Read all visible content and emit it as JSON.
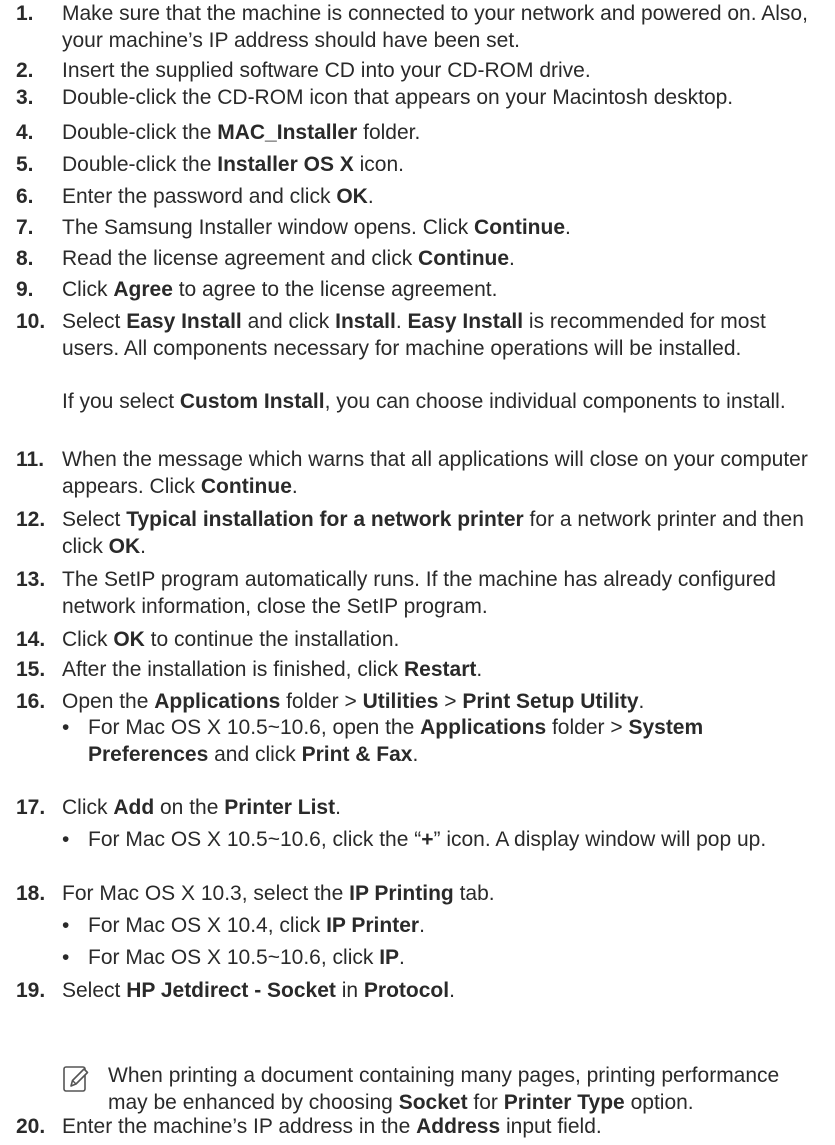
{
  "steps": [
    {
      "num": "1.",
      "segments": [
        [
          "Make sure that the machine is connected to your network and powered on. Also, your machine’s IP address should have been set.",
          false
        ]
      ]
    },
    {
      "num": "2.",
      "segments": [
        [
          "Insert the supplied software CD into your CD-ROM drive.",
          false
        ]
      ]
    },
    {
      "num": "3.",
      "segments": [
        [
          "Double-click the CD-ROM icon that appears on your Macintosh desktop.",
          false
        ]
      ]
    },
    {
      "num": "4.",
      "segments": [
        [
          "Double-click the ",
          false
        ],
        [
          "MAC_Installer",
          true
        ],
        [
          " folder.",
          false
        ]
      ]
    },
    {
      "num": "5.",
      "segments": [
        [
          "Double-click the ",
          false
        ],
        [
          "Installer OS X",
          true
        ],
        [
          " icon.",
          false
        ]
      ]
    },
    {
      "num": "6.",
      "segments": [
        [
          "Enter the password and click ",
          false
        ],
        [
          "OK",
          true
        ],
        [
          ".",
          false
        ]
      ]
    },
    {
      "num": "7.",
      "segments": [
        [
          "The Samsung Installer window opens. Click ",
          false
        ],
        [
          "Continue",
          true
        ],
        [
          ".",
          false
        ]
      ]
    },
    {
      "num": "8.",
      "segments": [
        [
          "Read the license agreement and click ",
          false
        ],
        [
          "Continue",
          true
        ],
        [
          ".",
          false
        ]
      ]
    },
    {
      "num": "9.",
      "segments": [
        [
          "Click ",
          false
        ],
        [
          "Agree",
          true
        ],
        [
          " to agree to the license agreement.",
          false
        ]
      ]
    },
    {
      "num": "10.",
      "segments": [
        [
          "Select ",
          false
        ],
        [
          "Easy Install",
          true
        ],
        [
          " and click ",
          false
        ],
        [
          "Install",
          true
        ],
        [
          ". ",
          false
        ],
        [
          "Easy Install",
          true
        ],
        [
          " is recommended for most users. All components necessary for machine operations will be installed.",
          false
        ]
      ]
    },
    {
      "num": "",
      "segments": [
        [
          "If you select ",
          false
        ],
        [
          "Custom Install",
          true
        ],
        [
          ", you can choose individual components to install.",
          false
        ]
      ]
    },
    {
      "num": "11.",
      "segments": [
        [
          "When the message which warns that all applications will close on your computer appears. Click ",
          false
        ],
        [
          "Continue",
          true
        ],
        [
          ".",
          false
        ]
      ]
    },
    {
      "num": "12.",
      "segments": [
        [
          "Select ",
          false
        ],
        [
          "Typical installation for a network printer",
          true
        ],
        [
          " for a network printer and then click ",
          false
        ],
        [
          "OK",
          true
        ],
        [
          ".",
          false
        ]
      ]
    },
    {
      "num": "13.",
      "segments": [
        [
          "The SetIP program automatically runs. If the machine has already configured network information, close the SetIP program.",
          false
        ]
      ]
    },
    {
      "num": "14.",
      "segments": [
        [
          "Click ",
          false
        ],
        [
          "OK",
          true
        ],
        [
          " to continue the installation.",
          false
        ]
      ]
    },
    {
      "num": "15.",
      "segments": [
        [
          "After the installation is finished, click ",
          false
        ],
        [
          "Restart",
          true
        ],
        [
          ".",
          false
        ]
      ]
    },
    {
      "num": "16.",
      "segments": [
        [
          "Open the ",
          false
        ],
        [
          "Applications",
          true
        ],
        [
          " folder > ",
          false
        ],
        [
          "Utilities",
          true
        ],
        [
          " > ",
          false
        ],
        [
          "Print Setup Utility",
          true
        ],
        [
          ".",
          false
        ]
      ]
    },
    {
      "num": "•",
      "sub": true,
      "segments": [
        [
          "For Mac OS X 10.5~10.6, open the ",
          false
        ],
        [
          "Applications",
          true
        ],
        [
          " folder > ",
          false
        ],
        [
          "System Preferences",
          true
        ],
        [
          " and click ",
          false
        ],
        [
          "Print & Fax",
          true
        ],
        [
          ".",
          false
        ]
      ]
    },
    {
      "num": "17.",
      "segments": [
        [
          "Click ",
          false
        ],
        [
          "Add",
          true
        ],
        [
          " on the ",
          false
        ],
        [
          "Printer List",
          true
        ],
        [
          ".",
          false
        ]
      ]
    },
    {
      "num": "•",
      "sub": true,
      "segments": [
        [
          "For Mac OS X 10.5~10.6, click the “",
          false
        ],
        [
          "+",
          true
        ],
        [
          "” icon. A display window will pop up.",
          false
        ]
      ]
    },
    {
      "num": "18.",
      "segments": [
        [
          "For Mac OS X 10.3, select the ",
          false
        ],
        [
          "IP Printing",
          true
        ],
        [
          " tab.",
          false
        ]
      ]
    },
    {
      "num": "•",
      "sub": true,
      "segments": [
        [
          "For Mac OS X 10.4, click ",
          false
        ],
        [
          "IP Printer",
          true
        ],
        [
          ".",
          false
        ]
      ]
    },
    {
      "num": "•",
      "sub": true,
      "segments": [
        [
          "For Mac OS X 10.5~10.6, click ",
          false
        ],
        [
          "IP",
          true
        ],
        [
          ".",
          false
        ]
      ]
    },
    {
      "num": "19.",
      "segments": [
        [
          "Select ",
          false
        ],
        [
          "HP Jetdirect - Socket",
          true
        ],
        [
          " in ",
          false
        ],
        [
          "Protocol",
          true
        ],
        [
          ".",
          false
        ]
      ]
    },
    {
      "num": "",
      "note": true,
      "icon": "note-pencil-icon",
      "segments": [
        [
          "When printing a document containing many pages, printing performance may be enhanced by choosing ",
          false
        ],
        [
          "Socket",
          true
        ],
        [
          " for ",
          false
        ],
        [
          "Printer Type",
          true
        ],
        [
          " option.",
          false
        ]
      ]
    },
    {
      "num": "20.",
      "segments": [
        [
          "Enter the machine’s IP address in the ",
          false
        ],
        [
          "Address",
          true
        ],
        [
          " input field.",
          false
        ]
      ]
    }
  ],
  "colors": {
    "text": "#2a2a2a",
    "note_icon": "#555555"
  }
}
